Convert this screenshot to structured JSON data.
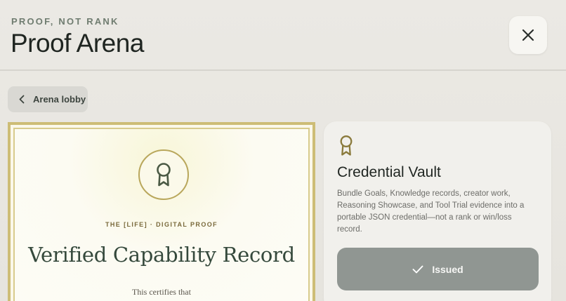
{
  "header": {
    "eyebrow": "PROOF, NOT RANK",
    "title": "Proof Arena",
    "close_icon": "close-icon"
  },
  "nav": {
    "back_label": "Arena lobby",
    "back_icon": "chevron-left-icon"
  },
  "certificate": {
    "icon": "award-ribbon-icon",
    "eyebrow": "THE [LIFE] · DIGITAL PROOF",
    "title": "Verified Capability Record",
    "certifies_text": "This certifies that"
  },
  "vault": {
    "icon": "award-ribbon-icon",
    "title": "Credential Vault",
    "description": "Bundle Goals, Knowledge records, creator work, Reasoning Showcase, and Tool Trial evidence into a portable JSON credential—not a rank or win/loss record.",
    "button_label": "Issued",
    "button_icon": "checkmark-icon"
  },
  "colors": {
    "background": "#e8e6e1",
    "accent_gold": "#cdbd76",
    "olive": "#8a7a3c",
    "cert_title": "#35493c",
    "issued_button": "#909692"
  }
}
